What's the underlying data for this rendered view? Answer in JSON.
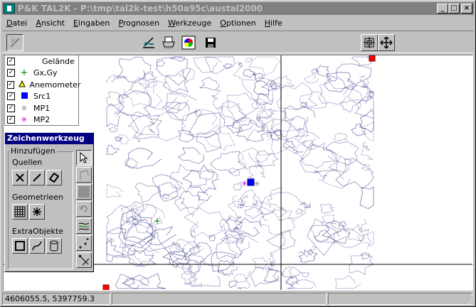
{
  "window": {
    "title": "P&K TAL2K - P:\\tmp\\tal2k-test\\h50a95c\\austal2000",
    "minimize": "_",
    "maximize": "□",
    "close": "×"
  },
  "menu": [
    {
      "label": "Datei",
      "key": "D",
      "rest": "atei"
    },
    {
      "label": "Ansicht",
      "key": "A",
      "rest": "nsicht"
    },
    {
      "label": "Eingaben",
      "key": "E",
      "rest": "ingaben"
    },
    {
      "label": "Prognosen",
      "key": "P",
      "rest": "rognosen"
    },
    {
      "label": "Werkzeuge",
      "key": "W",
      "rest": "erkzeuge"
    },
    {
      "label": "Optionen",
      "key": "O",
      "rest": "ptionen"
    },
    {
      "label": "Hilfe",
      "key": "H",
      "rest": "ilfe"
    }
  ],
  "toolbar": {
    "icons": [
      "cursor-tool-icon",
      "draw-tool-icon",
      "print-icon",
      "color-palette-icon",
      "save-icon",
      "zoom-all-icon",
      "pan-icon"
    ]
  },
  "layers": [
    {
      "label": "Gelände",
      "checked": true,
      "symbol": "",
      "color": "#000000"
    },
    {
      "label": "Gx,Gy",
      "checked": true,
      "symbol": "+",
      "color": "#008000"
    },
    {
      "label": "Anemometer",
      "checked": true,
      "symbol": "△",
      "color": "#000000"
    },
    {
      "label": "Src1",
      "checked": true,
      "symbol": "■",
      "color": "#0000ff"
    },
    {
      "label": "MP1",
      "checked": true,
      "symbol": "✳",
      "color": "#808080"
    },
    {
      "label": "MP2",
      "checked": true,
      "symbol": "✳",
      "color": "#cc00cc"
    }
  ],
  "palette": {
    "title": "Zeichenwerkzeug",
    "group_label": "Hinzufügen",
    "sources_label": "Quellen",
    "geometry_label": "Geometrieen",
    "extra_label": "ExtraObjekte"
  },
  "status": {
    "coords": "4606055.5, 5397759.3",
    "pane2": "",
    "pane3": ""
  },
  "colors": {
    "contour": "#1a1a7a",
    "selection_marker": "#ff0000",
    "title_inactive": "#808080",
    "palette_title": "#000080"
  }
}
